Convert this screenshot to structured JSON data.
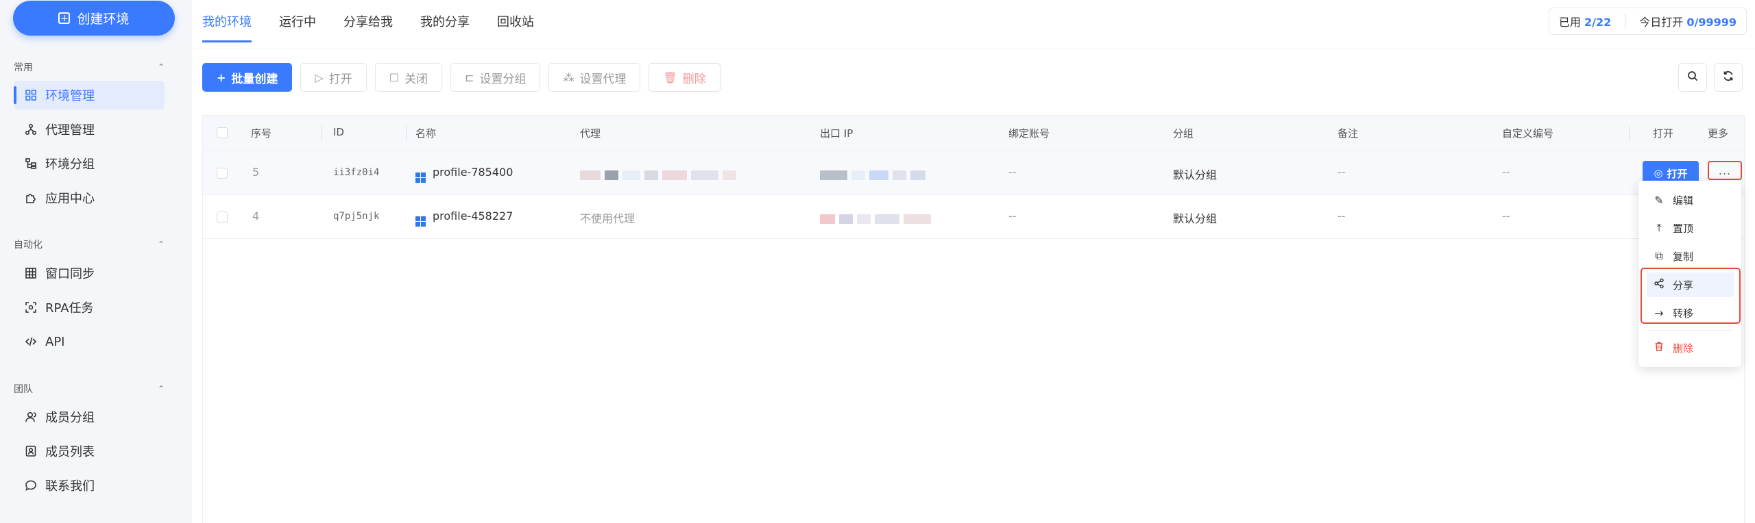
{
  "sidebar": {
    "create_label": "创建环境",
    "sections": [
      {
        "title": "常用",
        "items": [
          {
            "label": "环境管理",
            "icon": "grid-icon"
          },
          {
            "label": "代理管理",
            "icon": "network-icon"
          },
          {
            "label": "环境分组",
            "icon": "tree-icon"
          },
          {
            "label": "应用中心",
            "icon": "puzzle-icon"
          }
        ]
      },
      {
        "title": "自动化",
        "items": [
          {
            "label": "窗口同步",
            "icon": "table-icon"
          },
          {
            "label": "RPA任务",
            "icon": "scan-icon"
          },
          {
            "label": "API",
            "icon": "code-icon"
          }
        ]
      },
      {
        "title": "团队",
        "items": [
          {
            "label": "成员分组",
            "icon": "users-icon"
          },
          {
            "label": "成员列表",
            "icon": "contact-icon"
          },
          {
            "label": "联系我们",
            "icon": "chat-icon"
          }
        ]
      }
    ]
  },
  "tabs": [
    "我的环境",
    "运行中",
    "分享给我",
    "我的分享",
    "回收站"
  ],
  "usage": {
    "used_label": "已用",
    "used_value": "2/22",
    "today_label": "今日打开",
    "today_value": "0/99999"
  },
  "toolbar": {
    "batch_create": "批量创建",
    "open": "打开",
    "close": "关闭",
    "set_group": "设置分组",
    "set_proxy": "设置代理",
    "delete": "删除"
  },
  "table": {
    "headers": {
      "seq": "序号",
      "id": "ID",
      "name": "名称",
      "proxy": "代理",
      "ip": "出口 IP",
      "account": "绑定账号",
      "group": "分组",
      "note": "备注",
      "custom_no": "自定义编号",
      "open": "打开",
      "more": "更多"
    },
    "rows": [
      {
        "seq": "5",
        "id": "ii3fz0i4",
        "name": "profile-785400",
        "proxy": "",
        "account": "--",
        "group": "默认分组",
        "note": "--",
        "custom_no": "--"
      },
      {
        "seq": "4",
        "id": "q7pj5njk",
        "name": "profile-458227",
        "proxy": "不使用代理",
        "account": "--",
        "group": "默认分组",
        "note": "--",
        "custom_no": "--"
      }
    ],
    "open_button": "打开",
    "more_button": "..."
  },
  "menu": {
    "items": [
      {
        "label": "编辑",
        "icon": "pencil-icon"
      },
      {
        "label": "置顶",
        "icon": "pin-top-icon"
      },
      {
        "label": "复制",
        "icon": "copy-icon"
      },
      {
        "label": "分享",
        "icon": "share-icon"
      },
      {
        "label": "转移",
        "icon": "arrow-right-icon"
      },
      {
        "label": "删除",
        "icon": "trash-icon"
      }
    ]
  },
  "colors": {
    "accent": "#3a7afe",
    "danger": "#e24b3b"
  }
}
